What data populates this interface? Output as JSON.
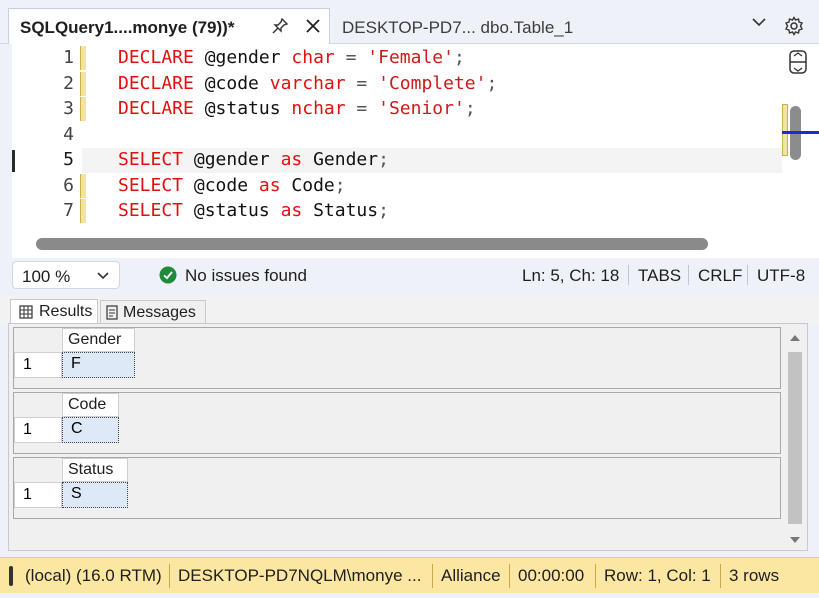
{
  "tabs": {
    "active": {
      "title": "SQLQuery1....monye (79))*",
      "pin_icon": "pin-icon",
      "close_icon": "close-icon"
    },
    "inactive": {
      "title": "DESKTOP-PD7... dbo.Table_1"
    },
    "overflow_icon": "chevron-down-icon",
    "settings_icon": "gear-icon"
  },
  "editor": {
    "lines": [
      {
        "num": "1",
        "parts": [
          {
            "t": "DECLARE ",
            "c": "kw"
          },
          {
            "t": "@gender ",
            "c": "id"
          },
          {
            "t": "char",
            "c": "kw"
          },
          {
            "t": " = ",
            "c": "punc"
          },
          {
            "t": "'Female'",
            "c": "str"
          },
          {
            "t": ";",
            "c": "punc"
          }
        ]
      },
      {
        "num": "2",
        "parts": [
          {
            "t": "DECLARE ",
            "c": "kw"
          },
          {
            "t": "@code ",
            "c": "id"
          },
          {
            "t": "varchar",
            "c": "kw"
          },
          {
            "t": " = ",
            "c": "punc"
          },
          {
            "t": "'Complete'",
            "c": "str"
          },
          {
            "t": ";",
            "c": "punc"
          }
        ]
      },
      {
        "num": "3",
        "parts": [
          {
            "t": "DECLARE ",
            "c": "kw"
          },
          {
            "t": "@status ",
            "c": "id"
          },
          {
            "t": "nchar",
            "c": "kw"
          },
          {
            "t": " = ",
            "c": "punc"
          },
          {
            "t": "'Senior'",
            "c": "str"
          },
          {
            "t": ";",
            "c": "punc"
          }
        ]
      },
      {
        "num": "4",
        "parts": []
      },
      {
        "num": "5",
        "parts": [
          {
            "t": "SELECT ",
            "c": "kw"
          },
          {
            "t": "@gender ",
            "c": "id"
          },
          {
            "t": "as ",
            "c": "kw"
          },
          {
            "t": "Gender",
            "c": "id"
          },
          {
            "t": ";",
            "c": "punc"
          }
        ]
      },
      {
        "num": "6",
        "parts": [
          {
            "t": "SELECT ",
            "c": "kw"
          },
          {
            "t": "@code ",
            "c": "id"
          },
          {
            "t": "as ",
            "c": "kw"
          },
          {
            "t": "Code",
            "c": "id"
          },
          {
            "t": ";",
            "c": "punc"
          }
        ]
      },
      {
        "num": "7",
        "parts": [
          {
            "t": "SELECT ",
            "c": "kw"
          },
          {
            "t": "@status ",
            "c": "id"
          },
          {
            "t": "as ",
            "c": "kw"
          },
          {
            "t": "Status",
            "c": "id"
          },
          {
            "t": ";",
            "c": "punc"
          }
        ]
      }
    ],
    "current_line": "5"
  },
  "editor_status": {
    "zoom": "100 %",
    "issues": "No issues found",
    "position": "Ln: 5, Ch: 18",
    "indent": "TABS",
    "line_ending": "CRLF",
    "encoding": "UTF-8"
  },
  "results": {
    "tabs": [
      {
        "label": "Results",
        "icon": "grid-icon"
      },
      {
        "label": "Messages",
        "icon": "messages-icon"
      }
    ],
    "grids": [
      {
        "column": "Gender",
        "row_num": "1",
        "value": "F"
      },
      {
        "column": "Code",
        "row_num": "1",
        "value": "C"
      },
      {
        "column": "Status",
        "row_num": "1",
        "value": "S"
      }
    ]
  },
  "bottom_status": {
    "server": "(local) (16.0 RTM)",
    "login": "DESKTOP-PD7NQLM\\monye ...",
    "database": "Alliance",
    "elapsed": "00:00:00",
    "cursor": "Row: 1, Col: 1",
    "rows": "3 rows"
  },
  "colors": {
    "keyword": "#e01010",
    "string": "#cc1a1a",
    "status_bar": "#fbe7a1",
    "success": "#1e8a3a"
  }
}
